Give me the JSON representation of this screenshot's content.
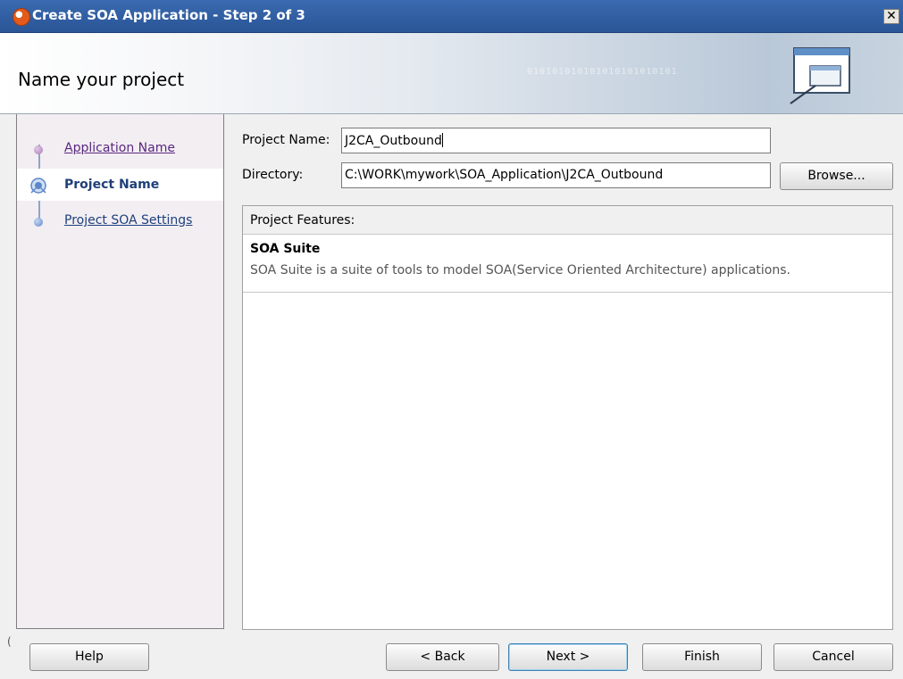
{
  "window": {
    "title": "Create SOA Application - Step 2 of 3",
    "close_label": "✕"
  },
  "header": {
    "title": "Name your project",
    "binary_text": "010101010101010101010101"
  },
  "steps": [
    {
      "label": "Application Name"
    },
    {
      "label": "Project Name"
    },
    {
      "label": "Project SOA Settings"
    }
  ],
  "form": {
    "project_name_label": "Project Name:",
    "project_name_value": "J2CA_Outbound",
    "directory_label": "Directory:",
    "directory_value": "C:\\WORK\\mywork\\SOA_Application\\J2CA_Outbound",
    "browse_label": "Browse..."
  },
  "features": {
    "header": "Project Features:",
    "items": [
      {
        "name": "SOA Suite",
        "description": "SOA Suite is a suite of tools to model SOA(Service Oriented Architecture) applications."
      }
    ]
  },
  "buttons": {
    "help": "Help",
    "back": "< Back",
    "next": "Next >",
    "finish": "Finish",
    "cancel": "Cancel"
  },
  "colors": {
    "titlebar": "#2a5596",
    "link": "#5a2880",
    "current_step": "#1f3f78"
  }
}
